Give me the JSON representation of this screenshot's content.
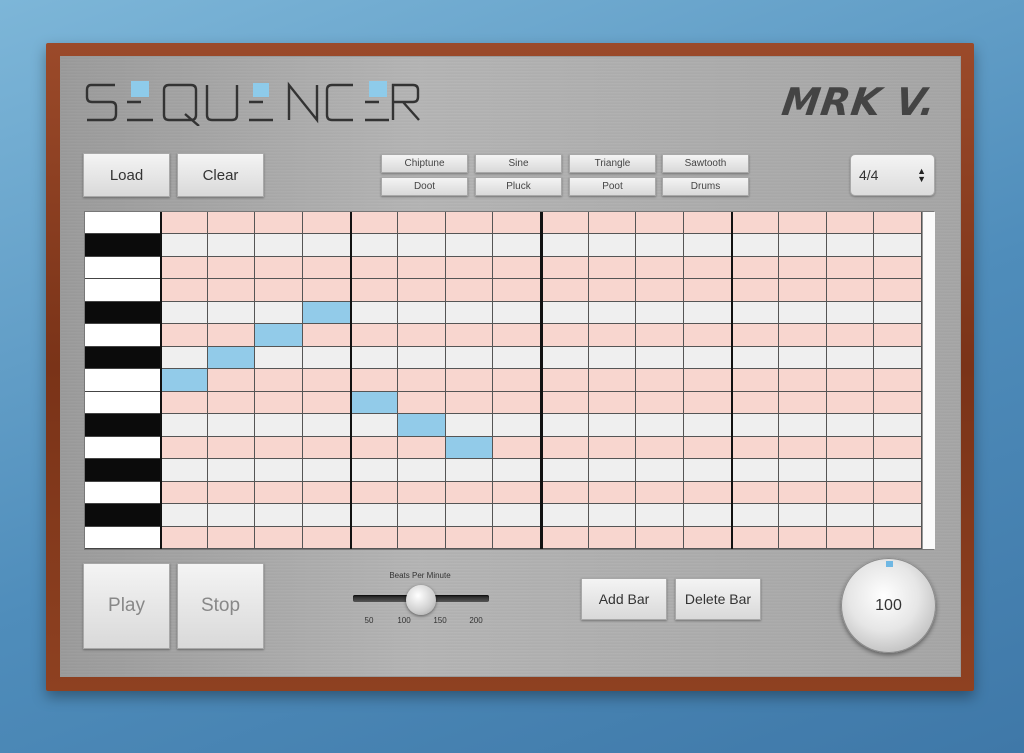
{
  "logo": {
    "title": "SEQUENCER",
    "signature": "MRK V."
  },
  "file_buttons": {
    "load": "Load",
    "clear": "Clear"
  },
  "instruments": [
    "Chiptune",
    "Sine",
    "Triangle",
    "Sawtooth",
    "Doot",
    "Pluck",
    "Poot",
    "Drums"
  ],
  "time_signature": {
    "selected": "4/4"
  },
  "piano_roll": {
    "rows": 15,
    "steps_per_bar": 4,
    "bars": 4,
    "key_pattern": [
      "white",
      "black",
      "white",
      "white",
      "black",
      "white",
      "black",
      "white",
      "white",
      "black",
      "white",
      "black",
      "white",
      "black",
      "white"
    ],
    "row_shade": [
      "pink",
      "gray",
      "pink",
      "pink",
      "gray",
      "pink",
      "gray",
      "pink",
      "pink",
      "gray",
      "pink",
      "gray",
      "pink",
      "gray",
      "pink"
    ],
    "active_notes": [
      {
        "step": 0,
        "row": 7
      },
      {
        "step": 1,
        "row": 6
      },
      {
        "step": 2,
        "row": 5
      },
      {
        "step": 3,
        "row": 4
      },
      {
        "step": 4,
        "row": 8
      },
      {
        "step": 5,
        "row": 9
      },
      {
        "step": 6,
        "row": 10
      }
    ]
  },
  "transport": {
    "play": "Play",
    "stop": "Stop"
  },
  "bpm_slider": {
    "label": "Beats Per Minute",
    "ticks": [
      "50",
      "100",
      "150",
      "200"
    ],
    "min": 50,
    "max": 200,
    "value": 100
  },
  "bar_buttons": {
    "add": "Add Bar",
    "delete": "Delete Bar"
  },
  "dial": {
    "value": "100"
  },
  "colors": {
    "active_note": "#92cbe9",
    "row_pink": "#f8d6cf",
    "row_gray": "#efefef",
    "accent": "#6fb7e3"
  }
}
